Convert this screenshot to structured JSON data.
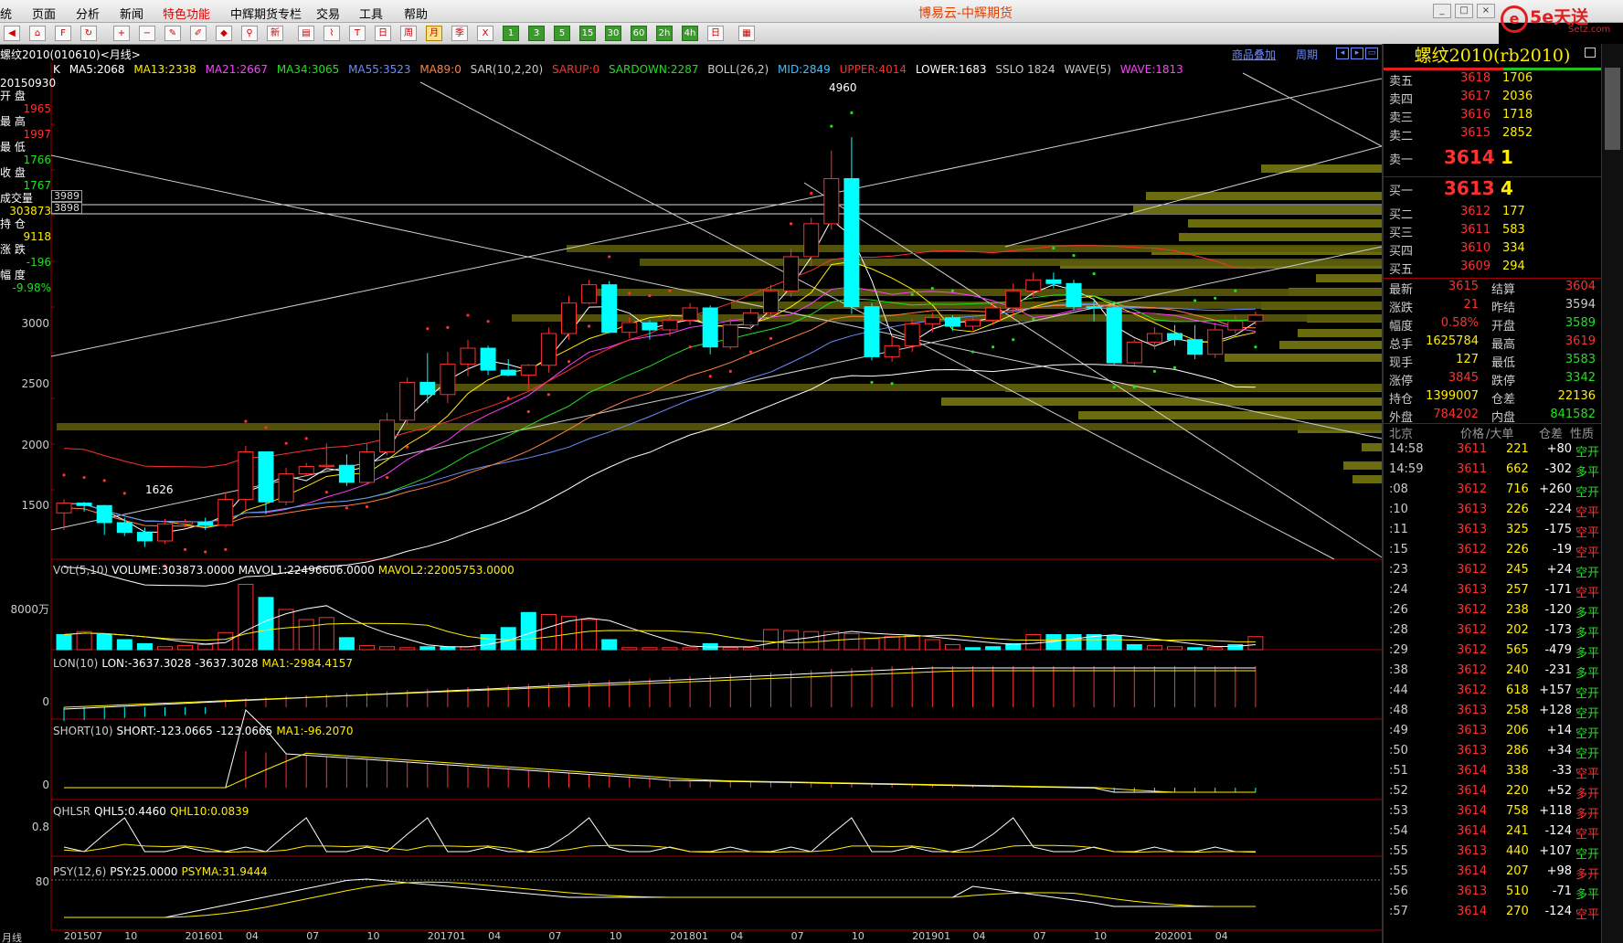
{
  "menu": {
    "items": [
      "统",
      "页面",
      "分析",
      "新闻",
      "特色功能",
      "中辉期货专栏",
      "交易",
      "工具",
      "帮助"
    ],
    "title": "博易云-中辉期货"
  },
  "logo": {
    "brand": "5e天送",
    "site": "Setz.com"
  },
  "toolbar": {
    "buttons": [
      "季",
      "X",
      "1",
      "3",
      "5",
      "15",
      "30",
      "60",
      "2h",
      "4h",
      "日",
      "周",
      "月"
    ]
  },
  "chart_header": {
    "symbol": "螺纹2010(010610)<月线>",
    "overlay": "商品叠加",
    "period": "周期"
  },
  "indicators": {
    "k": "K",
    "ma5": "MA5:2068",
    "ma13": "MA13:2338",
    "ma21": "MA21:2667",
    "ma34": "MA34:3065",
    "ma55": "MA55:3523",
    "ma89": "MA89:0",
    "sar": "SAR(10,2,20)",
    "sarup": "SARUP:0",
    "sardown": "SARDOWN:2287",
    "boll": "BOLL(26,2)",
    "mid": "MID:2849",
    "upper": "UPPER:4014",
    "lower": "LOWER:1683",
    "sslo": "SSLO 1824",
    "wave": "WAVE(5)",
    "waveval": "WAVE:1813"
  },
  "left_info": {
    "date": "20150930",
    "open_l": "开 盘",
    "open_v": "1965",
    "high_l": "最 高",
    "high_v": "1997",
    "low_l": "最 低",
    "low_v": "1766",
    "close_l": "收 盘",
    "close_v": "1767",
    "vol_l": "成交量",
    "vol_v": "303873",
    "oi_l": "持 仓",
    "oi_v": "9118",
    "chg_l": "涨 跌",
    "chg_v": "-196",
    "pct_l": "幅 度",
    "pct_v": "-9.98%"
  },
  "price_axis": [
    "3000",
    "2500",
    "2000",
    "1500"
  ],
  "annotations": {
    "peak": "4960",
    "trough": "1626",
    "line1": "3989",
    "line2": "3898"
  },
  "vol_panel": {
    "name": "VOL(5,10)",
    "volume": "VOLUME:303873.0000",
    "mavol1": "MAVOL1:22496606.0000",
    "mavol2": "MAVOL2:22005753.0000",
    "axis": "8000万"
  },
  "lon_panel": {
    "name": "LON(10)",
    "lon": "LON:-3637.3028",
    "val": "-3637.3028",
    "ma": "MA1:-2984.4157",
    "axis": "0"
  },
  "short_panel": {
    "name": "SHORT(10)",
    "short": "SHORT:-123.0665",
    "val": "-123.0665",
    "ma": "MA1:-96.2070",
    "axis": "0"
  },
  "qhlsr_panel": {
    "name": "QHLSR",
    "q5": "QHL5:0.4460",
    "q10": "QHL10:0.0839",
    "axis": "0.8"
  },
  "psy_panel": {
    "name": "PSY(12,6)",
    "psy": "PSY:25.0000",
    "psyma": "PSYMA:31.9444",
    "axis": "80"
  },
  "x_axis": {
    "label": "月线",
    "ticks": [
      "201507",
      "10",
      "201601",
      "04",
      "07",
      "10",
      "201701",
      "04",
      "07",
      "10",
      "201801",
      "04",
      "07",
      "10",
      "201901",
      "04",
      "07",
      "10",
      "202001",
      "04"
    ]
  },
  "quote": {
    "title": "螺纹2010(rb2010)",
    "asks": [
      {
        "l": "卖五",
        "p": "3618",
        "v": "1706"
      },
      {
        "l": "卖四",
        "p": "3617",
        "v": "2036"
      },
      {
        "l": "卖三",
        "p": "3616",
        "v": "1718"
      },
      {
        "l": "卖二",
        "p": "3615",
        "v": "2852"
      },
      {
        "l": "卖一",
        "p": "3614",
        "v": "1"
      }
    ],
    "bids": [
      {
        "l": "买一",
        "p": "3613",
        "v": "4"
      },
      {
        "l": "买二",
        "p": "3612",
        "v": "177"
      },
      {
        "l": "买三",
        "p": "3611",
        "v": "583"
      },
      {
        "l": "买四",
        "p": "3610",
        "v": "334"
      },
      {
        "l": "买五",
        "p": "3609",
        "v": "294"
      }
    ],
    "stats": [
      {
        "k1": "最新",
        "v1": "3615",
        "c1": "#ff3030",
        "k2": "结算",
        "v2": "3604",
        "c2": "#ff3030"
      },
      {
        "k1": "涨跌",
        "v1": "21",
        "c1": "#ff3030",
        "k2": "昨结",
        "v2": "3594",
        "c2": "#cccccc"
      },
      {
        "k1": "幅度",
        "v1": "0.58%",
        "c1": "#ff3030",
        "k2": "开盘",
        "v2": "3589",
        "c2": "#20e020"
      },
      {
        "k1": "总手",
        "v1": "1625784",
        "c1": "#ffee00",
        "k2": "最高",
        "v2": "3619",
        "c2": "#ff3030"
      },
      {
        "k1": "现手",
        "v1": "127",
        "c1": "#ffee00",
        "k2": "最低",
        "v2": "3583",
        "c2": "#20e020"
      },
      {
        "k1": "涨停",
        "v1": "3845",
        "c1": "#ff3030",
        "k2": "跌停",
        "v2": "3342",
        "c2": "#20e020"
      },
      {
        "k1": "持仓",
        "v1": "1399007",
        "c1": "#ffee00",
        "k2": "仓差",
        "v2": "22136",
        "c2": "#ffee00"
      },
      {
        "k1": "外盘",
        "v1": "784202",
        "c1": "#ff3030",
        "k2": "内盘",
        "v2": "841582",
        "c2": "#20e020"
      }
    ],
    "trade_head": {
      "a": "北京",
      "b": "价格",
      "c": "/大单",
      "d": "仓差",
      "e": "性质"
    },
    "trades": [
      {
        "t": "14:58",
        "p": "3611",
        "v": "221",
        "d": "+80",
        "n": "空开",
        "dc": "#ffffff",
        "nc": "#20e020"
      },
      {
        "t": "14:59",
        "p": "3611",
        "v": "662",
        "d": "-302",
        "n": "多平",
        "dc": "#ffffff",
        "nc": "#20e020"
      },
      {
        "t": ":08",
        "p": "3612",
        "v": "716",
        "d": "+260",
        "n": "空开",
        "dc": "#ffffff",
        "nc": "#20e020"
      },
      {
        "t": ":10",
        "p": "3613",
        "v": "226",
        "d": "-224",
        "n": "空平",
        "dc": "#ffffff",
        "nc": "#ff3030"
      },
      {
        "t": ":11",
        "p": "3613",
        "v": "325",
        "d": "-175",
        "n": "空平",
        "dc": "#ffffff",
        "nc": "#ff3030"
      },
      {
        "t": ":15",
        "p": "3612",
        "v": "226",
        "d": "-19",
        "n": "空平",
        "dc": "#ffffff",
        "nc": "#ff3030"
      },
      {
        "t": ":23",
        "p": "3612",
        "v": "245",
        "d": "+24",
        "n": "空开",
        "dc": "#ffffff",
        "nc": "#20e020"
      },
      {
        "t": ":24",
        "p": "3613",
        "v": "257",
        "d": "-171",
        "n": "空平",
        "dc": "#ffffff",
        "nc": "#ff3030"
      },
      {
        "t": ":26",
        "p": "3612",
        "v": "238",
        "d": "-120",
        "n": "多平",
        "dc": "#ffffff",
        "nc": "#20e020"
      },
      {
        "t": ":28",
        "p": "3612",
        "v": "202",
        "d": "-173",
        "n": "多平",
        "dc": "#ffffff",
        "nc": "#20e020"
      },
      {
        "t": ":29",
        "p": "3612",
        "v": "565",
        "d": "-479",
        "n": "多平",
        "dc": "#ffffff",
        "nc": "#20e020"
      },
      {
        "t": ":38",
        "p": "3612",
        "v": "240",
        "d": "-231",
        "n": "多平",
        "dc": "#ffffff",
        "nc": "#20e020"
      },
      {
        "t": ":44",
        "p": "3612",
        "v": "618",
        "d": "+157",
        "n": "空开",
        "dc": "#ffffff",
        "nc": "#20e020"
      },
      {
        "t": ":48",
        "p": "3613",
        "v": "258",
        "d": "+128",
        "n": "空开",
        "dc": "#ffffff",
        "nc": "#20e020"
      },
      {
        "t": ":49",
        "p": "3613",
        "v": "206",
        "d": "+14",
        "n": "空开",
        "dc": "#ffffff",
        "nc": "#20e020"
      },
      {
        "t": ":50",
        "p": "3613",
        "v": "286",
        "d": "+34",
        "n": "空开",
        "dc": "#ffffff",
        "nc": "#20e020"
      },
      {
        "t": ":51",
        "p": "3614",
        "v": "338",
        "d": "-33",
        "n": "空平",
        "dc": "#ffffff",
        "nc": "#ff3030"
      },
      {
        "t": ":52",
        "p": "3614",
        "v": "220",
        "d": "+52",
        "n": "多开",
        "dc": "#ffffff",
        "nc": "#ff3030"
      },
      {
        "t": ":53",
        "p": "3614",
        "v": "758",
        "d": "+118",
        "n": "多开",
        "dc": "#ffffff",
        "nc": "#ff3030"
      },
      {
        "t": ":54",
        "p": "3614",
        "v": "241",
        "d": "-124",
        "n": "空平",
        "dc": "#ffffff",
        "nc": "#ff3030"
      },
      {
        "t": ":55",
        "p": "3613",
        "v": "440",
        "d": "+107",
        "n": "空开",
        "dc": "#ffffff",
        "nc": "#20e020"
      },
      {
        "t": ":55",
        "p": "3614",
        "v": "207",
        "d": "+98",
        "n": "多开",
        "dc": "#ffffff",
        "nc": "#ff3030"
      },
      {
        "t": ":56",
        "p": "3613",
        "v": "510",
        "d": "-71",
        "n": "多平",
        "dc": "#ffffff",
        "nc": "#20e020"
      },
      {
        "t": ":57",
        "p": "3614",
        "v": "270",
        "d": "-124",
        "n": "空平",
        "dc": "#ffffff",
        "nc": "#ff3030"
      }
    ]
  },
  "candles": [
    [
      1880,
      1990,
      1740,
      1960
    ],
    [
      1960,
      1970,
      1890,
      1940
    ],
    [
      1940,
      1945,
      1700,
      1800
    ],
    [
      1800,
      1840,
      1690,
      1720
    ],
    [
      1720,
      1760,
      1600,
      1650
    ],
    [
      1650,
      1830,
      1626,
      1790
    ],
    [
      1790,
      1830,
      1760,
      1805
    ],
    [
      1805,
      1840,
      1740,
      1780
    ],
    [
      1780,
      2050,
      1760,
      1990
    ],
    [
      1990,
      2430,
      1900,
      2380
    ],
    [
      2380,
      2380,
      1870,
      1970
    ],
    [
      1970,
      2250,
      1940,
      2200
    ],
    [
      2200,
      2290,
      2180,
      2260
    ],
    [
      2260,
      2450,
      2230,
      2270
    ],
    [
      2270,
      2360,
      2100,
      2130
    ],
    [
      2130,
      2450,
      2110,
      2380
    ],
    [
      2380,
      2700,
      2350,
      2640
    ],
    [
      2640,
      2990,
      2600,
      2950
    ],
    [
      2950,
      3190,
      2780,
      2850
    ],
    [
      2850,
      3200,
      2780,
      3100
    ],
    [
      3100,
      3300,
      3000,
      3230
    ],
    [
      3230,
      3250,
      3010,
      3050
    ],
    [
      3050,
      3140,
      3000,
      3010
    ],
    [
      3010,
      3100,
      2890,
      3090
    ],
    [
      3090,
      3400,
      3030,
      3350
    ],
    [
      3350,
      3660,
      3300,
      3600
    ],
    [
      3600,
      3790,
      3590,
      3750
    ],
    [
      3750,
      3780,
      3350,
      3360
    ],
    [
      3360,
      3480,
      3310,
      3440
    ],
    [
      3440,
      3460,
      3300,
      3380
    ],
    [
      3380,
      3500,
      3330,
      3460
    ],
    [
      3460,
      3600,
      3420,
      3560
    ],
    [
      3560,
      3580,
      3180,
      3240
    ],
    [
      3240,
      3470,
      3220,
      3420
    ],
    [
      3420,
      3560,
      3380,
      3520
    ],
    [
      3520,
      3750,
      3490,
      3700
    ],
    [
      3700,
      4050,
      3650,
      3980
    ],
    [
      3980,
      4300,
      3900,
      4250
    ],
    [
      4250,
      4850,
      4200,
      4620
    ],
    [
      4620,
      4960,
      3510,
      3570
    ],
    [
      3570,
      3600,
      3130,
      3160
    ],
    [
      3160,
      3330,
      3120,
      3250
    ],
    [
      3250,
      3470,
      3200,
      3430
    ],
    [
      3430,
      3520,
      3360,
      3480
    ],
    [
      3480,
      3500,
      3370,
      3410
    ],
    [
      3410,
      3480,
      3380,
      3460
    ],
    [
      3460,
      3600,
      3420,
      3560
    ],
    [
      3560,
      3760,
      3480,
      3700
    ],
    [
      3700,
      3850,
      3650,
      3790
    ],
    [
      3790,
      3850,
      3720,
      3760
    ],
    [
      3760,
      3790,
      3540,
      3570
    ],
    [
      3570,
      3640,
      3450,
      3560
    ],
    [
      3560,
      3610,
      3090,
      3110
    ],
    [
      3110,
      3300,
      3090,
      3280
    ],
    [
      3280,
      3400,
      3220,
      3350
    ],
    [
      3350,
      3420,
      3250,
      3300
    ],
    [
      3300,
      3420,
      3140,
      3180
    ],
    [
      3180,
      3440,
      3150,
      3380
    ],
    [
      3380,
      3500,
      3350,
      3450
    ],
    [
      3450,
      3530,
      3420,
      3500
    ]
  ],
  "vol_bars": [
    [
      15,
      1
    ],
    [
      18,
      0
    ],
    [
      15,
      1
    ],
    [
      10,
      1
    ],
    [
      6,
      1
    ],
    [
      3,
      0
    ],
    [
      4,
      0
    ],
    [
      5,
      0
    ],
    [
      17,
      0
    ],
    [
      65,
      0
    ],
    [
      52,
      1
    ],
    [
      40,
      0
    ],
    [
      30,
      0
    ],
    [
      32,
      0
    ],
    [
      12,
      1
    ],
    [
      4,
      0
    ],
    [
      3,
      0
    ],
    [
      2,
      0
    ],
    [
      3,
      1
    ],
    [
      3,
      1
    ],
    [
      3,
      0
    ],
    [
      15,
      1
    ],
    [
      22,
      1
    ],
    [
      37,
      1
    ],
    [
      35,
      0
    ],
    [
      33,
      0
    ],
    [
      30,
      0
    ],
    [
      10,
      1
    ],
    [
      2,
      0
    ],
    [
      2,
      0
    ],
    [
      2,
      0
    ],
    [
      2,
      0
    ],
    [
      6,
      1
    ],
    [
      2,
      0
    ],
    [
      2,
      0
    ],
    [
      20,
      0
    ],
    [
      19,
      0
    ],
    [
      18,
      0
    ],
    [
      18,
      0
    ],
    [
      16,
      0
    ],
    [
      11,
      0
    ],
    [
      13,
      0
    ],
    [
      14,
      0
    ],
    [
      10,
      0
    ],
    [
      5,
      0
    ],
    [
      2,
      1
    ],
    [
      3,
      1
    ],
    [
      6,
      1
    ],
    [
      15,
      0
    ],
    [
      15,
      1
    ],
    [
      15,
      1
    ],
    [
      15,
      1
    ],
    [
      14,
      1
    ],
    [
      5,
      1
    ],
    [
      4,
      0
    ],
    [
      3,
      0
    ],
    [
      2,
      1
    ],
    [
      2,
      0
    ],
    [
      5,
      1
    ],
    [
      13,
      0
    ]
  ]
}
